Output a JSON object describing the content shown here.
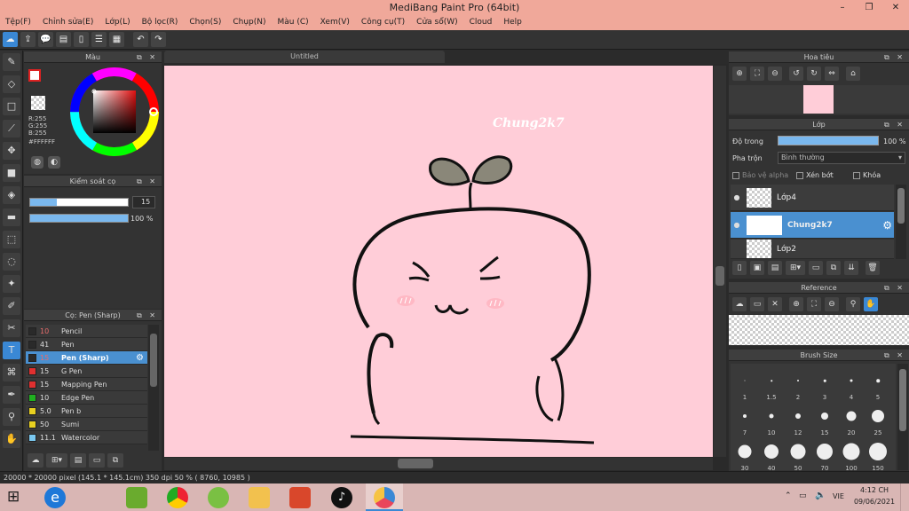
{
  "window": {
    "title": "MediBang Paint Pro (64bit)",
    "controls": [
      "–",
      "❐",
      "✕"
    ]
  },
  "menu": [
    "Tệp(F)",
    "Chỉnh sửa(E)",
    "Lớp(L)",
    "Bộ lọc(R)",
    "Chọn(S)",
    "Chụp(N)",
    "Màu (C)",
    "Xem(V)",
    "Công cụ(T)",
    "Cửa sổ(W)",
    "Cloud",
    "Help"
  ],
  "color_panel": {
    "title": "Màu",
    "r": "R:255",
    "g": "G:255",
    "b": "B:255",
    "hex": "#FFFFFF"
  },
  "brush_control": {
    "title": "Kiểm soát cọ",
    "size": "15",
    "size_fraction": 0.27,
    "opacity": "100 %",
    "opacity_fraction": 1.0
  },
  "brush_list": {
    "title": "Cọ: Pen (Sharp)",
    "items": [
      {
        "size": "10",
        "name": "Pencil",
        "color": "#2a2a2a",
        "size_color": "#e76b6b"
      },
      {
        "size": "41",
        "name": "Pen",
        "color": "#2a2a2a",
        "size_color": "#dddddd"
      },
      {
        "size": "15",
        "name": "Pen (Sharp)",
        "color": "#2a2a2a",
        "size_color": "#e76b6b"
      },
      {
        "size": "15",
        "name": "G Pen",
        "color": "#e03030",
        "size_color": "#dddddd"
      },
      {
        "size": "15",
        "name": "Mapping Pen",
        "color": "#e03030",
        "size_color": "#dddddd"
      },
      {
        "size": "10",
        "name": "Edge Pen",
        "color": "#20b020",
        "size_color": "#dddddd"
      },
      {
        "size": "5.0",
        "name": "Pen b",
        "color": "#e8d020",
        "size_color": "#dddddd"
      },
      {
        "size": "50",
        "name": "Sumi",
        "color": "#e8d020",
        "size_color": "#dddddd"
      },
      {
        "size": "11.1",
        "name": "Watercolor",
        "color": "#7ac8f0",
        "size_color": "#dddddd"
      }
    ]
  },
  "document": {
    "tab": "Untitled",
    "signature": "Chung2k7"
  },
  "navigator": {
    "title": "Hoa tiêu"
  },
  "layers": {
    "title": "Lớp",
    "opacity_label": "Độ trong",
    "opacity_value": "100 %",
    "blend_label": "Pha trộn",
    "blend_value": "Bình thường",
    "protect_alpha": "Bảo vệ alpha",
    "clipping": "Xén bớt",
    "lock": "Khóa",
    "items": [
      {
        "name": "Lớp4"
      },
      {
        "name": "Chung2k7"
      },
      {
        "name": "Lớp2"
      }
    ]
  },
  "reference": {
    "title": "Reference"
  },
  "brush_size": {
    "title": "Brush Size",
    "row1": [
      "1",
      "1.5",
      "2",
      "3",
      "4",
      "5"
    ],
    "row2": [
      "7",
      "10",
      "12",
      "15",
      "20",
      "25"
    ],
    "row3": [
      "30",
      "40",
      "50",
      "70",
      "100",
      "150"
    ]
  },
  "status": {
    "text": "20000 * 20000 pixel   (145.1 * 145.1cm)   350 dpi   50 %   ( 8760, 10985 )"
  },
  "taskbar": {
    "language": "VIE",
    "time": "4:12 CH",
    "date": "09/06/2021"
  }
}
